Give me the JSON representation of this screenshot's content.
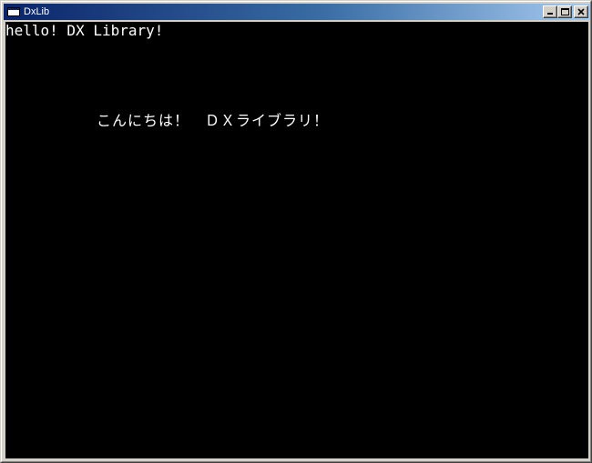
{
  "window": {
    "title": "DxLib",
    "icon": "app-window-icon",
    "controls": {
      "minimize_icon": "minimize-icon",
      "maximize_icon": "maximize-icon",
      "close_icon": "close-icon"
    },
    "titlebar_color_start": "#0a246a",
    "titlebar_color_end": "#a6caf0"
  },
  "screen": {
    "background": "#000000",
    "text_color": "#ffffff",
    "lines": [
      "hello! DX Library!",
      "こんにちは！　ＤＸライブラリ！"
    ]
  }
}
